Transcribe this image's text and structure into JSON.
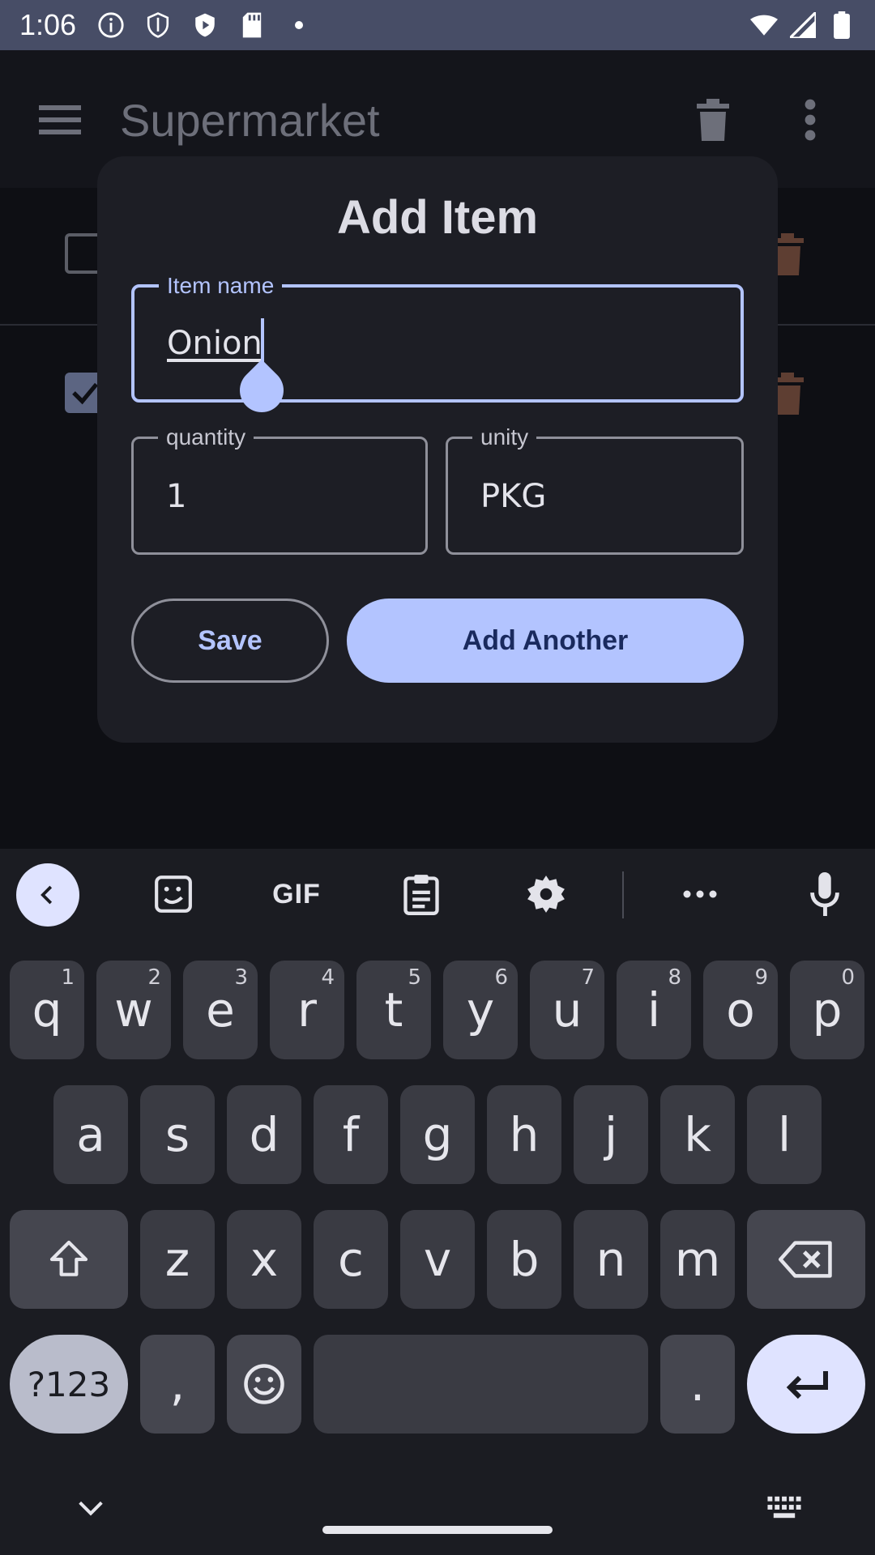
{
  "status_bar": {
    "time": "1:06",
    "left_icons": [
      "info-icon",
      "shield-icon",
      "play-shield-icon",
      "sd-card-icon",
      "dot-icon"
    ],
    "right_icons": [
      "wifi-icon",
      "signal-icon",
      "battery-icon"
    ]
  },
  "app_bar": {
    "title": "Supermarket",
    "icons": [
      "menu-icon",
      "delete-icon",
      "more-vert-icon"
    ]
  },
  "list": {
    "items": [
      {
        "checked": false
      },
      {
        "checked": true
      }
    ]
  },
  "dialog": {
    "title": "Add Item",
    "item_name": {
      "label": "Item name",
      "value": "Onion"
    },
    "quantity": {
      "label": "quantity",
      "value": "1"
    },
    "unity": {
      "label": "unity",
      "value": "PKG"
    },
    "save_label": "Save",
    "add_another_label": "Add Another"
  },
  "keyboard": {
    "toolbar": {
      "gif_label": "GIF"
    },
    "row1": [
      {
        "k": "q",
        "h": "1"
      },
      {
        "k": "w",
        "h": "2"
      },
      {
        "k": "e",
        "h": "3"
      },
      {
        "k": "r",
        "h": "4"
      },
      {
        "k": "t",
        "h": "5"
      },
      {
        "k": "y",
        "h": "6"
      },
      {
        "k": "u",
        "h": "7"
      },
      {
        "k": "i",
        "h": "8"
      },
      {
        "k": "o",
        "h": "9"
      },
      {
        "k": "p",
        "h": "0"
      }
    ],
    "row2": [
      "a",
      "s",
      "d",
      "f",
      "g",
      "h",
      "j",
      "k",
      "l"
    ],
    "row3": [
      "z",
      "x",
      "c",
      "v",
      "b",
      "n",
      "m"
    ],
    "symbols_label": "?123",
    "comma": ",",
    "period": "."
  },
  "colors": {
    "accent": "#b3c4ff",
    "status_bar": "#474d66",
    "dialog_bg": "#1d1e25",
    "keyboard_bg": "#1b1c22"
  }
}
